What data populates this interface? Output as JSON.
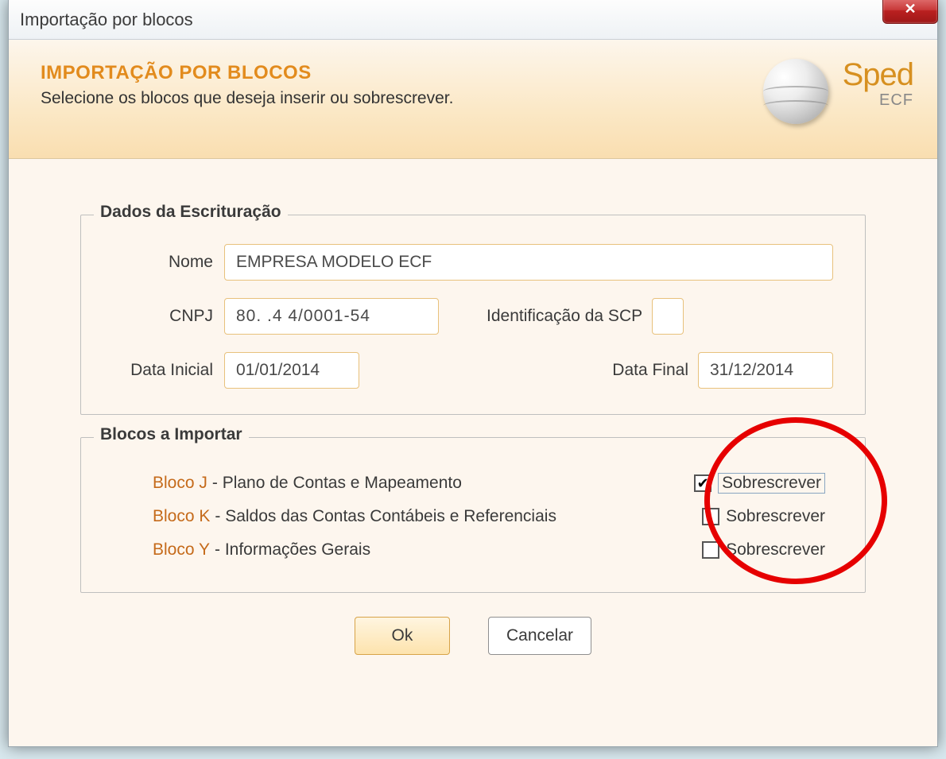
{
  "window": {
    "title": "Importação por blocos",
    "close_glyph": "✕"
  },
  "header": {
    "title": "IMPORTAÇÃO POR BLOCOS",
    "subtitle": "Selecione os blocos que deseja inserir ou sobrescrever.",
    "logo_text": "Sped",
    "logo_sub": "ECF"
  },
  "escrituracao": {
    "legend": "Dados da Escrituração",
    "nome_label": "Nome",
    "nome_value": "EMPRESA MODELO ECF",
    "cnpj_label": "CNPJ",
    "cnpj_value": "80.   .4   4/0001-54",
    "scp_label": "Identificação da SCP",
    "scp_value": "",
    "data_inicial_label": "Data Inicial",
    "data_inicial_value": "01/01/2014",
    "data_final_label": "Data Final",
    "data_final_value": "31/12/2014"
  },
  "blocos": {
    "legend": "Blocos a Importar",
    "overwrite_label": "Sobrescrever",
    "items": [
      {
        "code": "Bloco J",
        "desc": "- Plano de Contas e Mapeamento",
        "checked": true
      },
      {
        "code": "Bloco K",
        "desc": "- Saldos das Contas Contábeis e Referenciais",
        "checked": false
      },
      {
        "code": "Bloco Y",
        "desc": "- Informações Gerais",
        "checked": false
      }
    ]
  },
  "buttons": {
    "ok": "Ok",
    "cancel": "Cancelar"
  }
}
